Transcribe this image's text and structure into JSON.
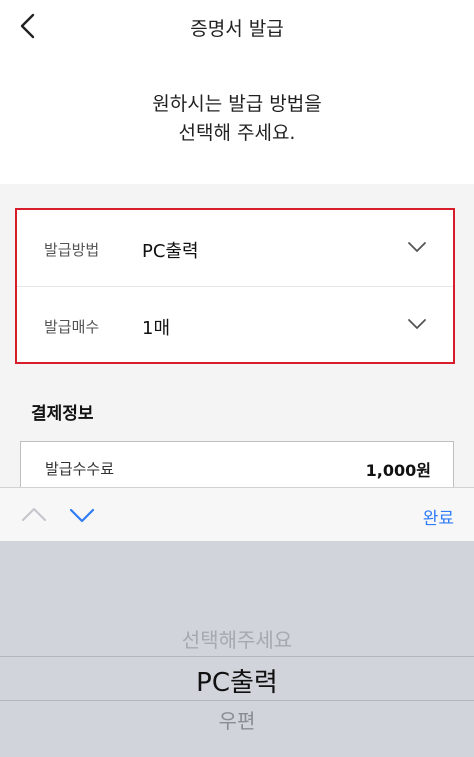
{
  "header": {
    "title": "증명서 발급",
    "back_icon": "chevron-left-icon"
  },
  "instruction": {
    "line1": "원하시는 발급 방법을",
    "line2": "선택해 주세요."
  },
  "form": {
    "method": {
      "label": "발급방법",
      "value": "PC출력"
    },
    "copies": {
      "label": "발급매수",
      "value": "1매"
    },
    "highlight_color": "#d71c2a"
  },
  "payment": {
    "title": "결제정보",
    "fee_label": "발급수수료",
    "fee_value": "1,000원"
  },
  "toolbar": {
    "prev_icon": "chevron-up-icon",
    "next_icon": "chevron-down-icon",
    "done_label": "완료",
    "accent_color": "#2f7cf6"
  },
  "picker": {
    "options": [
      "선택해주세요",
      "PC출력",
      "우편"
    ],
    "selected": "PC출력"
  }
}
